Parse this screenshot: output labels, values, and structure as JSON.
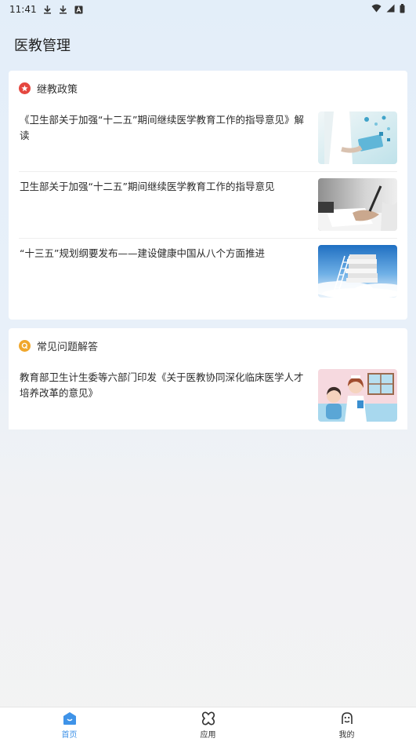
{
  "status_bar": {
    "time": "11:41"
  },
  "app": {
    "title": "医教管理"
  },
  "policy": {
    "title": "继教政策",
    "icon": "star-icon",
    "icon_color": "#e5473f",
    "items": [
      {
        "text": "《卫生部关于加强“十二五”期间继续医学教育工作的指导意见》解读",
        "thumb": "doctor-tablet-image"
      },
      {
        "text": "卫生部关于加强“十二五”期间继续医学教育工作的指导意见",
        "thumb": "signing-document-image"
      },
      {
        "text": "“十三五”规划纲要发布——建设健康中国从八个方面推进",
        "thumb": "books-sky-image"
      }
    ]
  },
  "faq": {
    "title": "常见问题解答",
    "icon": "q-icon",
    "icon_color": "#f0a72c",
    "items": [
      {
        "text": "教育部卫生计生委等六部门印发《关于医教协同深化临床医学人才培养改革的意见》",
        "thumb": "nurse-patient-image"
      }
    ]
  },
  "bottom_nav": {
    "active_color": "#3f93e8",
    "items": [
      {
        "label": "首页",
        "icon": "home-icon",
        "active": true
      },
      {
        "label": "应用",
        "icon": "apps-icon",
        "active": false
      },
      {
        "label": "我的",
        "icon": "profile-icon",
        "active": false
      }
    ]
  }
}
